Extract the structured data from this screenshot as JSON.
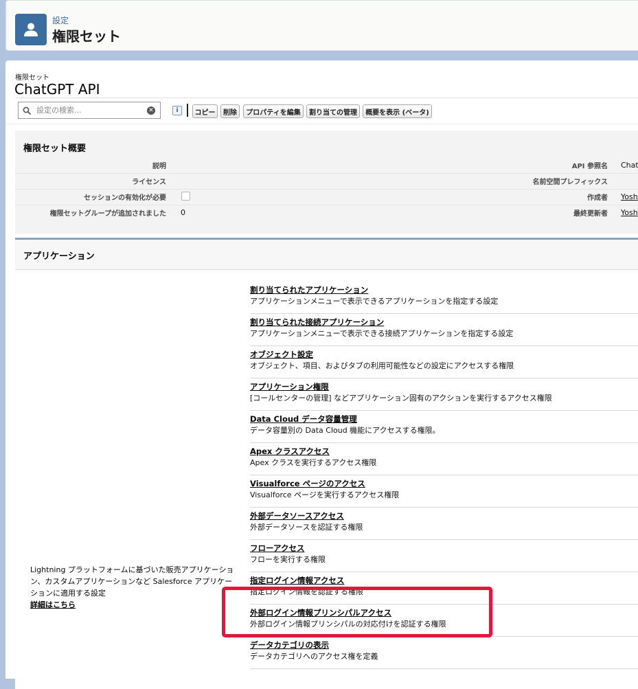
{
  "header": {
    "eyebrow": "設定",
    "title": "権限セット",
    "icon": "user-icon",
    "icon_color": "#3c6da0"
  },
  "permission_set": {
    "eyebrow": "権限セット",
    "name": "ChatGPT API"
  },
  "search": {
    "placeholder": "設定の検索..."
  },
  "toolbar": {
    "copy": "コピー",
    "delete": "削除",
    "edit_properties": "プロパティを編集",
    "manage_assignments": "割り当ての管理",
    "view_summary": "概要を表示 (ベータ)"
  },
  "overview": {
    "title": "権限セット概要",
    "description_label": "説明",
    "license_label": "ライセンス",
    "session_label": "セッションの有効化が必要",
    "groups_label": "権限セットグループが追加されました",
    "groups_value": "0",
    "api_name_label": "API 参照名",
    "api_name_value": "Chat",
    "namespace_label": "名前空間プレフィックス",
    "created_by_label": "作成者",
    "created_by_value": "Yosh",
    "modified_by_label": "最終更新者",
    "modified_by_value": "Yosh"
  },
  "apps": {
    "title": "アプリケーション",
    "description": "Lightning プラットフォームに基づいた販売アプリケーション、カスタムアプリケーションなど Salesforce アプリケーションに適用する設定",
    "more_link": "詳細はこちら",
    "items": [
      {
        "title": "割り当てられたアプリケーション",
        "desc": "アプリケーションメニューで表示できるアプリケーションを指定する設定"
      },
      {
        "title": "割り当てられた接続アプリケーション",
        "desc": "アプリケーションメニューで表示できる接続アプリケーションを指定する設定"
      },
      {
        "title": "オブジェクト設定",
        "desc": "オブジェクト、項目、およびタブの利用可能性などの設定にアクセスする権限"
      },
      {
        "title": "アプリケーション権限",
        "desc": "[コールセンターの管理] などアプリケーション固有のアクションを実行するアクセス権限"
      },
      {
        "title": "Data Cloud データ容量管理",
        "desc": "データ容量別の Data Cloud 機能にアクセスする権限。"
      },
      {
        "title": "Apex クラスアクセス",
        "desc": "Apex クラスを実行するアクセス権限"
      },
      {
        "title": "Visualforce ページのアクセス",
        "desc": "Visualforce ページを実行するアクセス権限"
      },
      {
        "title": "外部データソースアクセス",
        "desc": "外部データソースを認証する権限"
      },
      {
        "title": "フローアクセス",
        "desc": "フローを実行する権限"
      },
      {
        "title": "指定ログイン情報アクセス",
        "desc": "指定ログイン情報を認証する権限"
      },
      {
        "title": "外部ログイン情報プリンシパルアクセス",
        "desc": "外部ログイン情報プリンシパルの対応付けを認証する権限"
      },
      {
        "title": "データカテゴリの表示",
        "desc": "データカテゴリへのアクセス権を定義"
      }
    ]
  },
  "highlight_color": "#e2173a"
}
